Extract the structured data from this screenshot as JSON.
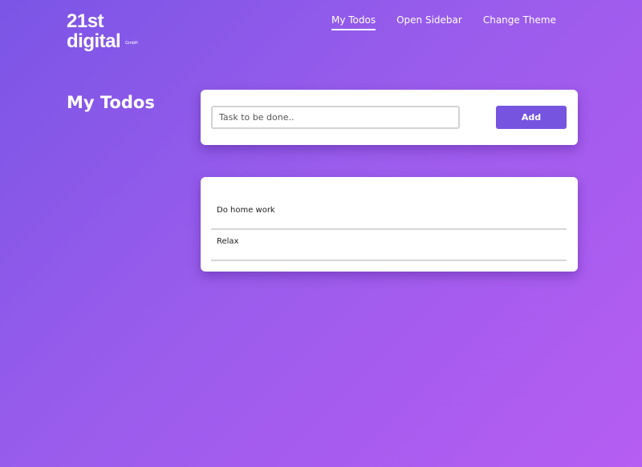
{
  "logo": {
    "line1": "21st",
    "line2": "digital",
    "suffix": "GmbH"
  },
  "nav": {
    "items": [
      {
        "label": "My Todos",
        "active": true
      },
      {
        "label": "Open Sidebar",
        "active": false
      },
      {
        "label": "Change Theme",
        "active": false
      }
    ]
  },
  "main": {
    "title": "My Todos"
  },
  "add_form": {
    "placeholder": "Task to be done..",
    "value": "",
    "button_label": "Add"
  },
  "todos": [
    {
      "text": "Do home work"
    },
    {
      "text": "Relax"
    }
  ],
  "colors": {
    "gradient_start": "#7b55e6",
    "gradient_end": "#b65df2",
    "accent": "#7654e0"
  }
}
